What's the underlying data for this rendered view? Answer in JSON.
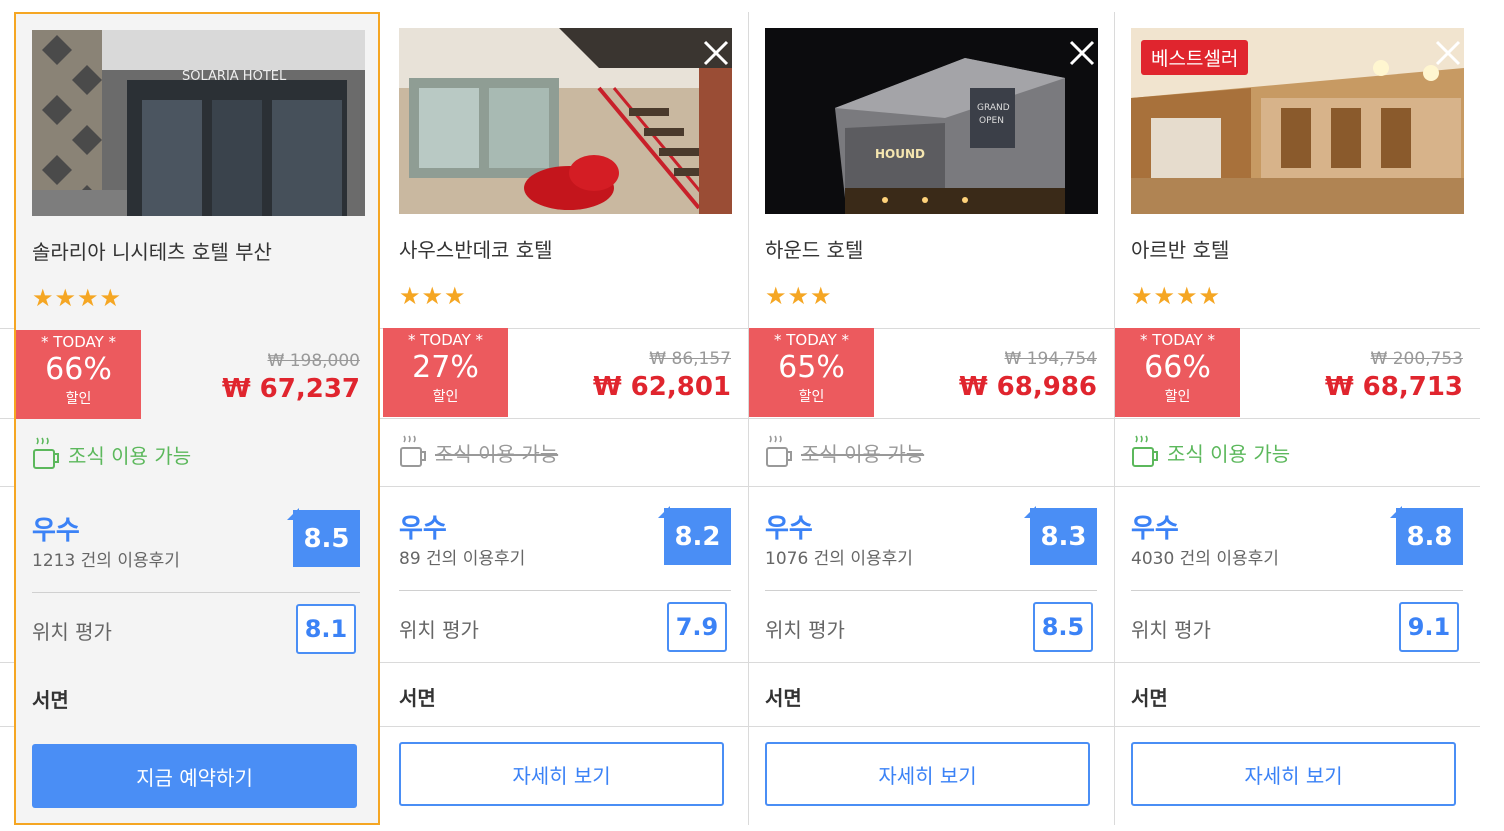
{
  "colors": {
    "accent": "#4a8ef5",
    "sale": "#ec5a5e",
    "price": "#e0252e",
    "star": "#f5a623",
    "breakfast": "#5cb85c",
    "selected_border": "#f5a623"
  },
  "hotels": [
    {
      "name": "솔라리아 니시테츠 호텔 부산",
      "stars": "★★★★",
      "star_count": 4,
      "today": "* TODAY *",
      "discount": "66%",
      "discount_label": "할인",
      "original_price": "₩ 198,000",
      "price": "₩ 67,237",
      "breakfast": "조식 이용 가능",
      "breakfast_available": true,
      "rating_text": "우수",
      "review_count": "1213 건의 이용후기",
      "rating_score": "8.5",
      "location_label": "위치 평가",
      "location_score": "8.1",
      "area": "서면",
      "button": "지금 예약하기",
      "selected": true,
      "bestseller": ""
    },
    {
      "name": "사우스반데코 호텔",
      "stars": "★★★",
      "star_count": 3,
      "today": "* TODAY *",
      "discount": "27%",
      "discount_label": "할인",
      "original_price": "₩ 86,157",
      "price": "₩ 62,801",
      "breakfast": "조식 이용 가능",
      "breakfast_available": false,
      "rating_text": "우수",
      "review_count": "89 건의 이용후기",
      "rating_score": "8.2",
      "location_label": "위치 평가",
      "location_score": "7.9",
      "area": "서면",
      "button": "자세히 보기",
      "selected": false,
      "bestseller": ""
    },
    {
      "name": "하운드 호텔",
      "stars": "★★★",
      "star_count": 3,
      "today": "* TODAY *",
      "discount": "65%",
      "discount_label": "할인",
      "original_price": "₩ 194,754",
      "price": "₩ 68,986",
      "breakfast": "조식 이용 가능",
      "breakfast_available": false,
      "rating_text": "우수",
      "review_count": "1076 건의 이용후기",
      "rating_score": "8.3",
      "location_label": "위치 평가",
      "location_score": "8.5",
      "area": "서면",
      "button": "자세히 보기",
      "selected": false,
      "bestseller": ""
    },
    {
      "name": "아르반 호텔",
      "stars": "★★★★",
      "star_count": 4,
      "today": "* TODAY *",
      "discount": "66%",
      "discount_label": "할인",
      "original_price": "₩ 200,753",
      "price": "₩ 68,713",
      "breakfast": "조식 이용 가능",
      "breakfast_available": true,
      "rating_text": "우수",
      "review_count": "4030 건의 이용후기",
      "rating_score": "8.8",
      "location_label": "위치 평가",
      "location_score": "9.1",
      "area": "서면",
      "button": "자세히 보기",
      "selected": false,
      "bestseller": "베스트셀러"
    }
  ],
  "images": [
    "hotel-photo-solaria",
    "hotel-photo-southbandeco",
    "hotel-photo-hound",
    "hotel-photo-arban"
  ],
  "logo_text_in_photo": [
    "SOLARIA HOTEL",
    "GRAND OPEN",
    "HOUND"
  ]
}
